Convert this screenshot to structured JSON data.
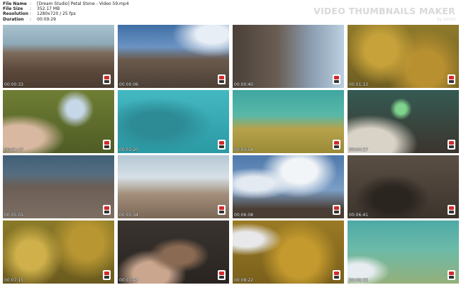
{
  "header": {
    "meta": [
      {
        "key": "File Name",
        "sep": ":",
        "value": "[Dream Studio] Petal Stone - Video 59.mp4"
      },
      {
        "key": "File Size",
        "sep": ":",
        "value": "352.17 MB"
      },
      {
        "key": "Resolution",
        "sep": ":",
        "value": "1280x720 / 25 fps"
      },
      {
        "key": "Duration",
        "sep": ":",
        "value": "00:09:29"
      }
    ],
    "brand_title": "VIDEO THUMBNAILS MAKER",
    "brand_sub": "by Jomio"
  },
  "thumbnails": [
    {
      "time": "00:00:33",
      "scene": "rocky-shore-sea"
    },
    {
      "time": "00:00:06",
      "scene": "person-on-rocks-sky"
    },
    {
      "time": "00:00:40",
      "scene": "rock-cliff-sea"
    },
    {
      "time": "00:01:13",
      "scene": "seaweed-bottom"
    },
    {
      "time": "00:01:47",
      "scene": "hand-with-knife"
    },
    {
      "time": "00:03:20",
      "scene": "underwater-teal"
    },
    {
      "time": "00:03:54",
      "scene": "underwater-seabed"
    },
    {
      "time": "00:04:27",
      "scene": "green-cloth-rocks"
    },
    {
      "time": "00:05:01",
      "scene": "shore-rocks-water"
    },
    {
      "time": "00:05:34",
      "scene": "person-on-shore"
    },
    {
      "time": "00:06:08",
      "scene": "person-sky-clouds"
    },
    {
      "time": "00:06:41",
      "scene": "dark-rock-closeup"
    },
    {
      "time": "00:07:15",
      "scene": "seaweed-closeup"
    },
    {
      "time": "00:07:48",
      "scene": "shell-in-hand"
    },
    {
      "time": "00:08:22",
      "scene": "seaweed-with-hand"
    },
    {
      "time": "00:08:55",
      "scene": "underwater-shallow"
    }
  ],
  "colors": {
    "brand": "#d9d9d9",
    "background": "#ffffff"
  }
}
